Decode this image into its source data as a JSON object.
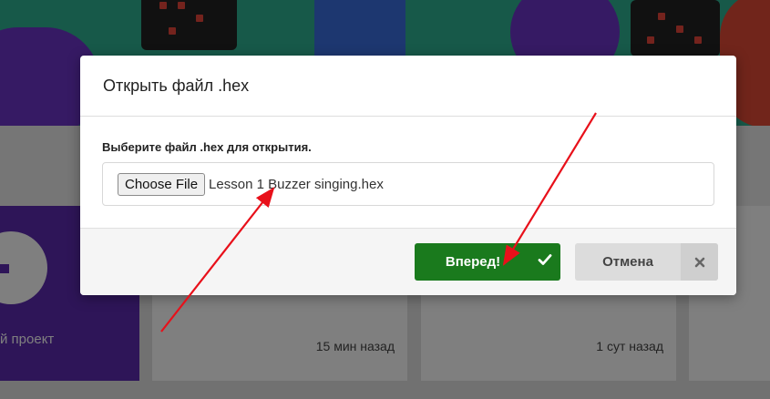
{
  "background": {
    "new_project_label": "й проект",
    "cards": [
      {
        "time": "15 мин назад"
      },
      {
        "time": "1 сут назад"
      }
    ]
  },
  "dialog": {
    "title": "Открыть файл .hex",
    "field_label": "Выберите файл .hex для открытия.",
    "choose_button_label": "Choose File",
    "selected_file": "Lesson 1 Buzzer singing.hex",
    "go_button_label": "Вперед!",
    "go_button_icon": "check-icon",
    "cancel_button_label": "Отмена",
    "cancel_button_icon": "close-icon"
  },
  "annotations": {
    "arrow_color": "#e8101a"
  },
  "colors": {
    "go_button": "#1a7a1d",
    "cancel_button": "#dcdcdc",
    "banner": "#2fb392",
    "new_project_card": "#5c2ab0"
  }
}
